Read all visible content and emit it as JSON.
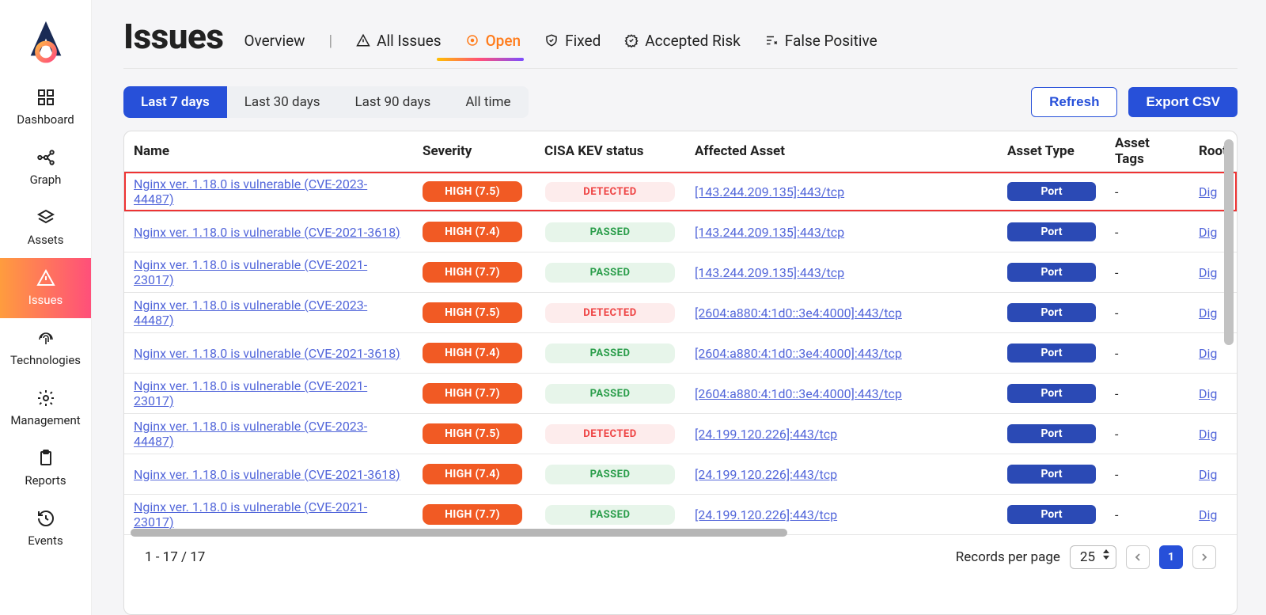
{
  "page_title": "Issues",
  "sidebar": {
    "items": [
      {
        "label": "Dashboard"
      },
      {
        "label": "Graph"
      },
      {
        "label": "Assets"
      },
      {
        "label": "Issues"
      },
      {
        "label": "Technologies"
      },
      {
        "label": "Management"
      },
      {
        "label": "Reports"
      },
      {
        "label": "Events"
      }
    ]
  },
  "view_tabs": {
    "overview": "Overview",
    "all": "All Issues",
    "open": "Open",
    "fixed": "Fixed",
    "accepted": "Accepted Risk",
    "false_pos": "False Positive"
  },
  "time_filters": {
    "d7": "Last 7 days",
    "d30": "Last 30 days",
    "d90": "Last 90 days",
    "all": "All time"
  },
  "buttons": {
    "refresh": "Refresh",
    "export": "Export CSV"
  },
  "columns": {
    "name": "Name",
    "severity": "Severity",
    "cisa": "CISA KEV status",
    "asset": "Affected Asset",
    "type": "Asset Type",
    "tags": "Asset Tags",
    "root": "Root"
  },
  "rows": [
    {
      "name": "Nginx ver. 1.18.0 is vulnerable (CVE-2023-44487)",
      "sev": "HIGH (7.5)",
      "cisa": "DETECTED",
      "asset": "[143.244.209.135]:443/tcp",
      "type": "Port",
      "tags": "-",
      "root": "Dig",
      "hl": true
    },
    {
      "name": "Nginx ver. 1.18.0 is vulnerable (CVE-2021-3618)",
      "sev": "HIGH (7.4)",
      "cisa": "PASSED",
      "asset": "[143.244.209.135]:443/tcp",
      "type": "Port",
      "tags": "-",
      "root": "Dig"
    },
    {
      "name": "Nginx ver. 1.18.0 is vulnerable (CVE-2021-23017)",
      "sev": "HIGH (7.7)",
      "cisa": "PASSED",
      "asset": "[143.244.209.135]:443/tcp",
      "type": "Port",
      "tags": "-",
      "root": "Dig"
    },
    {
      "name": "Nginx ver. 1.18.0 is vulnerable (CVE-2023-44487)",
      "sev": "HIGH (7.5)",
      "cisa": "DETECTED",
      "asset": "[2604:a880:4:1d0::3e4:4000]:443/tcp",
      "type": "Port",
      "tags": "-",
      "root": "Dig"
    },
    {
      "name": "Nginx ver. 1.18.0 is vulnerable (CVE-2021-3618)",
      "sev": "HIGH (7.4)",
      "cisa": "PASSED",
      "asset": "[2604:a880:4:1d0::3e4:4000]:443/tcp",
      "type": "Port",
      "tags": "-",
      "root": "Dig"
    },
    {
      "name": "Nginx ver. 1.18.0 is vulnerable (CVE-2021-23017)",
      "sev": "HIGH (7.7)",
      "cisa": "PASSED",
      "asset": "[2604:a880:4:1d0::3e4:4000]:443/tcp",
      "type": "Port",
      "tags": "-",
      "root": "Dig"
    },
    {
      "name": "Nginx ver. 1.18.0 is vulnerable (CVE-2023-44487)",
      "sev": "HIGH (7.5)",
      "cisa": "DETECTED",
      "asset": "[24.199.120.226]:443/tcp",
      "type": "Port",
      "tags": "-",
      "root": "Dig"
    },
    {
      "name": "Nginx ver. 1.18.0 is vulnerable (CVE-2021-3618)",
      "sev": "HIGH (7.4)",
      "cisa": "PASSED",
      "asset": "[24.199.120.226]:443/tcp",
      "type": "Port",
      "tags": "-",
      "root": "Dig"
    },
    {
      "name": "Nginx ver. 1.18.0 is vulnerable (CVE-2021-23017)",
      "sev": "HIGH (7.7)",
      "cisa": "PASSED",
      "asset": "[24.199.120.226]:443/tcp",
      "type": "Port",
      "tags": "-",
      "root": "Dig"
    }
  ],
  "footer": {
    "summary": "1 - 17 / 17",
    "rpp_label": "Records per page",
    "rpp_value": "25",
    "current_page": "1"
  }
}
